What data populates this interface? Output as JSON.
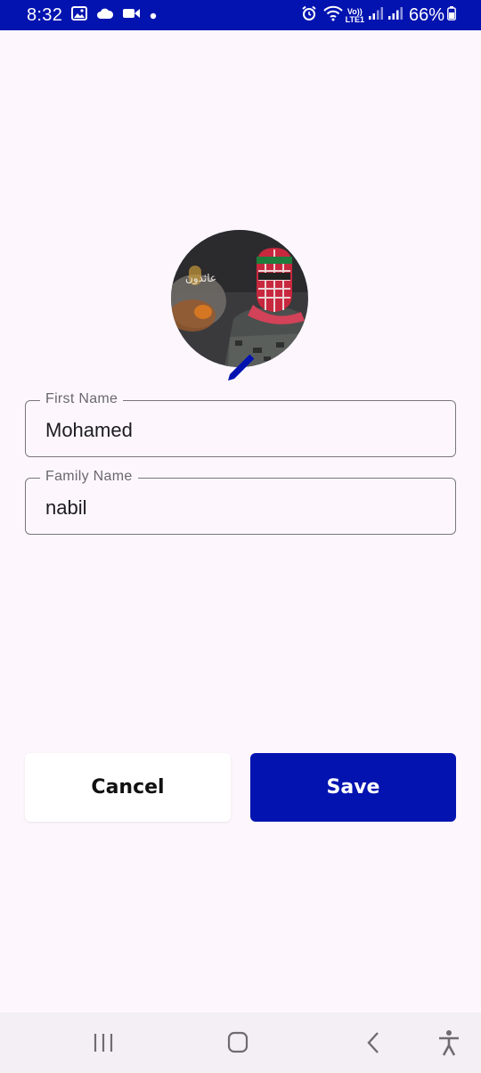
{
  "status_bar": {
    "time": "8:32",
    "battery": "66%",
    "left_icons": [
      "gallery-icon",
      "cloud-icon",
      "video-icon",
      "dot-icon"
    ],
    "right_icons": [
      "alarm-icon",
      "wifi-icon",
      "volte-icon",
      "signal-icon",
      "signal-icon",
      "battery-icon"
    ],
    "network_label": "Vo))\nLTE1"
  },
  "profile": {
    "avatar_icon": "profile-photo",
    "edit_icon": "pencil-icon",
    "avatar_caption": "عائدون"
  },
  "form": {
    "first_name_label": "First Name",
    "first_name_value": "Mohamed",
    "family_name_label": "Family Name",
    "family_name_value": "nabil"
  },
  "actions": {
    "cancel_label": "Cancel",
    "save_label": "Save"
  },
  "nav_bar": {
    "buttons": [
      "recent-apps-icon",
      "home-icon",
      "back-icon",
      "accessibility-icon"
    ]
  },
  "colors": {
    "primary": "#0313b0",
    "background": "#fdf7fd",
    "outline": "#7a7480"
  }
}
